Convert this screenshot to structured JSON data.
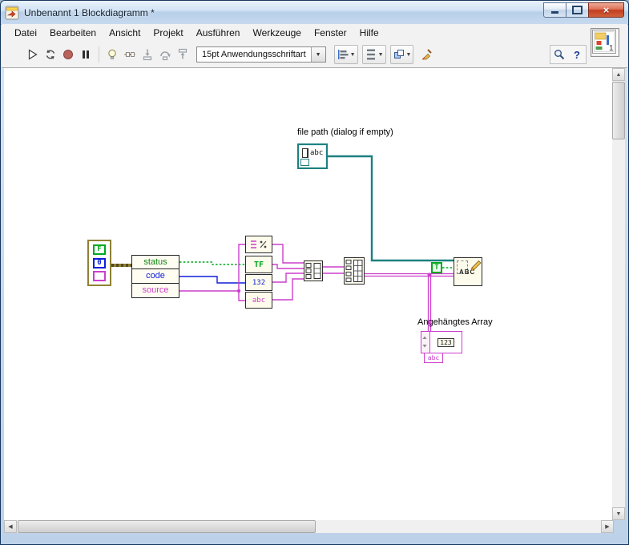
{
  "window": {
    "title": "Unbenannt 1 Blockdiagramm *"
  },
  "menu": {
    "items": [
      "Datei",
      "Bearbeiten",
      "Ansicht",
      "Projekt",
      "Ausführen",
      "Werkzeuge",
      "Fenster",
      "Hilfe"
    ]
  },
  "toolbar": {
    "font_selector": "15pt Anwendungsschriftart"
  },
  "vi_icon": {
    "label": "1"
  },
  "diagram": {
    "file_path_label": "file path (dialog if empty)",
    "appended_array_label": "Angehängtes Array",
    "unbundle_fields": [
      "status",
      "code",
      "source"
    ],
    "error_cluster": {
      "bool": "F",
      "num": "0"
    },
    "converters": {
      "bool": "TF",
      "num": "132",
      "str": "abc"
    },
    "true_constant": "T",
    "write_node_glyph": "ABC",
    "path_glyph": "abc",
    "array_element_glyph": "123",
    "array_string_glyph": "abc"
  },
  "colors": {
    "green": "#00a81e",
    "blue": "#0f1fd8",
    "pink": "#cc3fcc",
    "teal": "#1e8080",
    "olive": "#8f8136",
    "olive-dark": "#56491d"
  }
}
